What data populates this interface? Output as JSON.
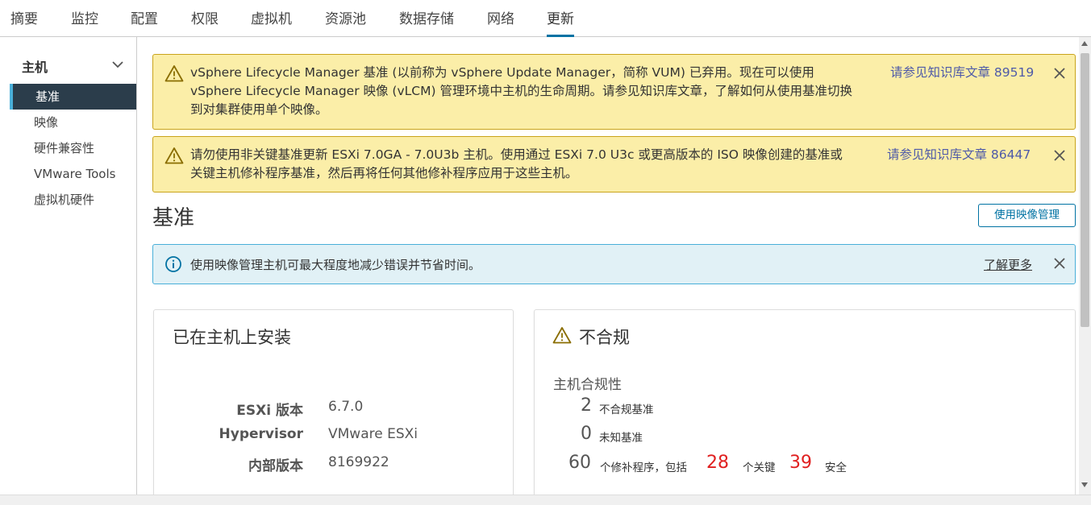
{
  "tabs": [
    {
      "label": "摘要"
    },
    {
      "label": "监控"
    },
    {
      "label": "配置"
    },
    {
      "label": "权限"
    },
    {
      "label": "虚拟机"
    },
    {
      "label": "资源池"
    },
    {
      "label": "数据存储"
    },
    {
      "label": "网络"
    },
    {
      "label": "更新",
      "active": true
    }
  ],
  "sidebar": {
    "heading": "主机",
    "items": [
      {
        "label": "基准",
        "active": true
      },
      {
        "label": "映像"
      },
      {
        "label": "硬件兼容性"
      },
      {
        "label": "VMware Tools"
      },
      {
        "label": "虚拟机硬件"
      }
    ]
  },
  "banners": [
    {
      "lines": [
        "vSphere Lifecycle Manager 基准 (以前称为 vSphere Update Manager，简称 VUM) 已弃用。现在可以使用",
        "vSphere Lifecycle Manager 映像 (vLCM) 管理环境中主机的生命周期。请参见知识库文章，了解如何从使用基准切换",
        "到对集群使用单个映像。"
      ],
      "link": "请参见知识库文章 89519"
    },
    {
      "lines": [
        "请勿使用非关键基准更新 ESXi 7.0GA - 7.0U3b 主机。使用通过 ESXi 7.0 U3c 或更高版本的 ISO 映像创建的基准或",
        "关键主机修补程序基准，然后再将任何其他修补程序应用于这些主机。"
      ],
      "link": "请参见知识库文章 86447"
    }
  ],
  "page": {
    "title": "基准",
    "image_button": "使用映像管理"
  },
  "info": {
    "text": "使用映像管理主机可最大程度地减少错误并节省时间。",
    "link": "了解更多"
  },
  "installed_card": {
    "title": "已在主机上安装",
    "rows": [
      {
        "key": "ESXi 版本",
        "value": "6.7.0"
      },
      {
        "key": "Hypervisor",
        "value": "VMware ESXi"
      },
      {
        "key": "内部版本",
        "value": "8169922"
      }
    ]
  },
  "compliance_card": {
    "title": "不合规",
    "subtitle": "主机合规性",
    "noncompliant_count": "2",
    "noncompliant_label": "不合规基准",
    "unknown_count": "0",
    "unknown_label": "未知基准",
    "patch_count": "60",
    "patch_label": "个修补程序，包括",
    "critical_count": "28",
    "critical_label": "个关键",
    "security_count": "39",
    "security_label": "安全"
  },
  "colors": {
    "warning_bg": "#fbeea8",
    "warning_border": "#c9a41c",
    "info_bg": "#e1f1f6",
    "info_border": "#49afd9",
    "accent": "#0072a3",
    "sidebar_active": "#2b3d4b",
    "critical_red": "#e02020"
  }
}
